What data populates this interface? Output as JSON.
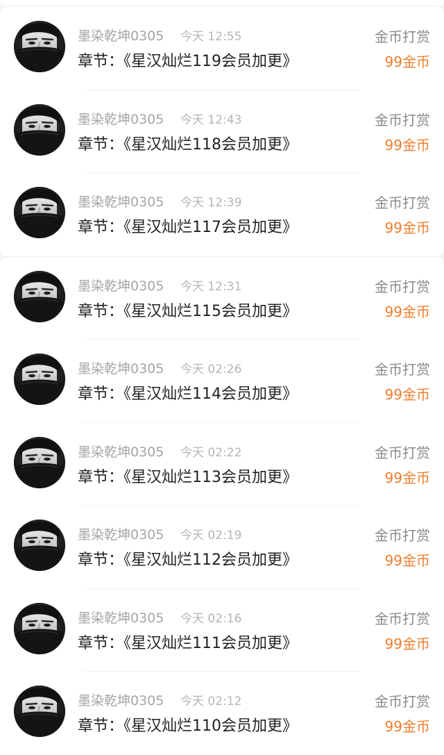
{
  "colors": {
    "background": "#f4f4f4",
    "card": "#ffffff",
    "username": "#a5a5a5",
    "time": "#b5b5b5",
    "chapter": "#222222",
    "reward_label": "#8a8a8a",
    "reward_amount_accent": "#ee7d2c"
  },
  "records": [
    {
      "avatar": "user-avatar",
      "username": "墨染乾坤0305",
      "time": "今天 12:55",
      "chapter": "章节：《星汉灿烂119会员加更》",
      "reward_type": "金币打赏",
      "reward_amount": "99金币"
    },
    {
      "avatar": "user-avatar",
      "username": "墨染乾坤0305",
      "time": "今天 12:43",
      "chapter": "章节：《星汉灿烂118会员加更》",
      "reward_type": "金币打赏",
      "reward_amount": "99金币"
    },
    {
      "avatar": "user-avatar",
      "username": "墨染乾坤0305",
      "time": "今天 12:39",
      "chapter": "章节：《星汉灿烂117会员加更》",
      "reward_type": "金币打赏",
      "reward_amount": "99金币"
    },
    {
      "avatar": "user-avatar",
      "username": "墨染乾坤0305",
      "time": "今天 12:31",
      "chapter": "章节：《星汉灿烂115会员加更》",
      "reward_type": "金币打赏",
      "reward_amount": "99金币"
    },
    {
      "avatar": "user-avatar",
      "username": "墨染乾坤0305",
      "time": "今天 02:26",
      "chapter": "章节：《星汉灿烂114会员加更》",
      "reward_type": "金币打赏",
      "reward_amount": "99金币"
    },
    {
      "avatar": "user-avatar",
      "username": "墨染乾坤0305",
      "time": "今天 02:22",
      "chapter": "章节：《星汉灿烂113会员加更》",
      "reward_type": "金币打赏",
      "reward_amount": "99金币"
    },
    {
      "avatar": "user-avatar",
      "username": "墨染乾坤0305",
      "time": "今天 02:19",
      "chapter": "章节：《星汉灿烂112会员加更》",
      "reward_type": "金币打赏",
      "reward_amount": "99金币"
    },
    {
      "avatar": "user-avatar",
      "username": "墨染乾坤0305",
      "time": "今天 02:16",
      "chapter": "章节：《星汉灿烂111会员加更》",
      "reward_type": "金币打赏",
      "reward_amount": "99金币"
    },
    {
      "avatar": "user-avatar",
      "username": "墨染乾坤0305",
      "time": "今天 02:12",
      "chapter": "章节：《星汉灿烂110会员加更》",
      "reward_type": "金币打赏",
      "reward_amount": "99金币"
    }
  ]
}
